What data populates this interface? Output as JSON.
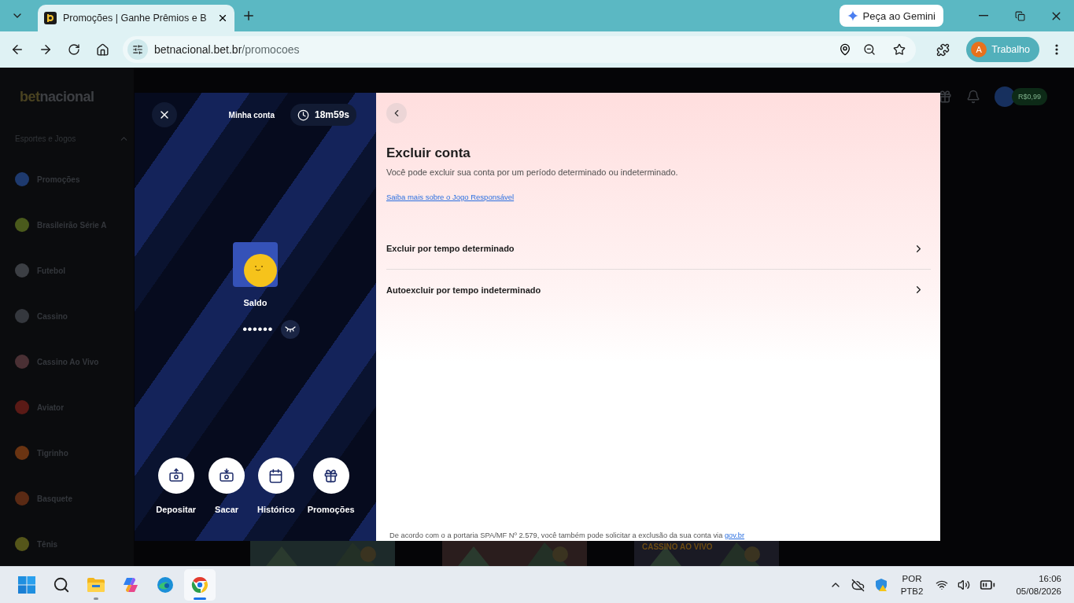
{
  "browser": {
    "tab": {
      "title": "Promoções | Ganhe Prêmios e B"
    },
    "gemini_button": "Peça ao Gemini",
    "url": {
      "host": "betnacional.bet.br",
      "path": "/promocoes"
    },
    "profile": {
      "initial": "A",
      "name": "Trabalho"
    }
  },
  "site": {
    "logo": {
      "part_1": "bet",
      "part_2": "nacional"
    },
    "header": {
      "balance": "R$0,99"
    },
    "sidebar": {
      "section": "Esportes e Jogos",
      "expanded": true,
      "items": [
        {
          "label": "Promoções",
          "color": "#1e3a6e"
        },
        {
          "label": "Brasileirão Série A",
          "color": "#4a5a1c"
        },
        {
          "label": "Futebol",
          "color": "#3c3f44"
        },
        {
          "label": "Cassino",
          "color": "#35383e"
        },
        {
          "label": "Cassino Ao Vivo",
          "color": "#4a3034"
        },
        {
          "label": "Aviator",
          "color": "#5a1a16"
        },
        {
          "label": "Tigrinho",
          "color": "#6a3412"
        },
        {
          "label": "Basquete",
          "color": "#5a2a14"
        },
        {
          "label": "Tênis",
          "color": "#55561a"
        }
      ]
    },
    "banners": [
      {
        "kind": "picture"
      },
      {
        "kind": "picture"
      },
      {
        "kind": "promo",
        "title": "CASSINO AO VIVO"
      }
    ]
  },
  "account_drawer": {
    "title": "Minha conta",
    "timer": "18m59s",
    "balance_label": "Saldo",
    "balance_masked": "••••••",
    "balance_hidden": true,
    "actions": [
      {
        "label": "Depositar",
        "kind": "deposit"
      },
      {
        "label": "Sacar",
        "kind": "withdraw"
      },
      {
        "label": "Histórico",
        "kind": "history"
      },
      {
        "label": "Promoções",
        "kind": "gift"
      }
    ]
  },
  "exclude_panel": {
    "title": "Excluir conta",
    "description": "Você pode excluir sua conta por um período determinado ou indeterminado.",
    "link": "Saiba mais sobre o Jogo Responsável",
    "options": [
      "Excluir por tempo determinado",
      "Autoexcluir por tempo indeterminado"
    ],
    "footer": {
      "text": "De acordo com o a portaria SPA/MF Nº 2.579, você também pode solicitar a exclusão da sua conta via",
      "link": "gov.br"
    }
  },
  "taskbar": {
    "apps": [
      {
        "kind": "start",
        "open": false,
        "selected": false
      },
      {
        "kind": "search",
        "open": false,
        "selected": false
      },
      {
        "kind": "explorer",
        "open": true,
        "selected": false
      },
      {
        "kind": "copilot",
        "open": false,
        "selected": false
      },
      {
        "kind": "edge",
        "open": false,
        "selected": false
      },
      {
        "kind": "chrome",
        "open": true,
        "selected": true
      }
    ],
    "language": [
      "POR",
      "PTB2"
    ],
    "time": "16:06",
    "date": "05/08/2026"
  }
}
